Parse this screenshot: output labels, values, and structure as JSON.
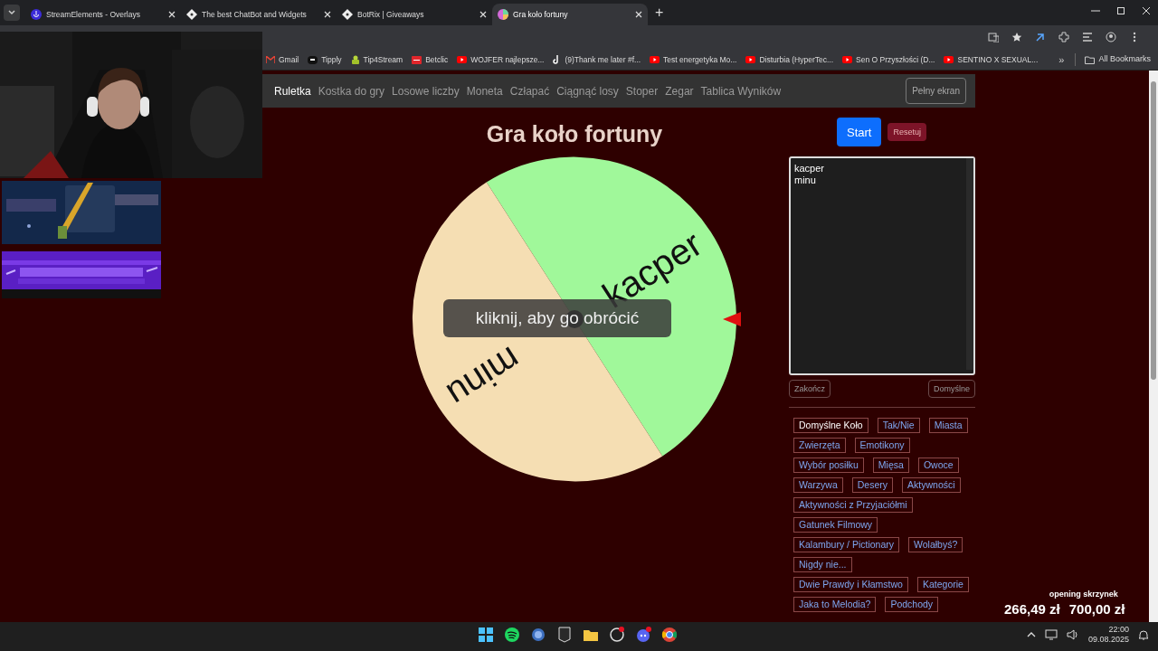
{
  "browser": {
    "tabs": [
      {
        "title": "StreamElements - Overlays",
        "kind": "streamelements",
        "selected": false
      },
      {
        "title": "The best ChatBot and Widgets",
        "kind": "diamond",
        "selected": false
      },
      {
        "title": "BotRix | Giveaways",
        "kind": "diamond",
        "selected": false
      },
      {
        "title": "Gra koło fortuny",
        "kind": "wheel",
        "selected": true
      }
    ],
    "bookmarks": [
      {
        "title": "Gmail",
        "kind": "gmail"
      },
      {
        "title": "Tipply",
        "kind": "tipply"
      },
      {
        "title": "Tip4Stream",
        "kind": "tip4stream"
      },
      {
        "title": "Betclic",
        "kind": "betclic"
      },
      {
        "title": "WOJFER najlepsze...",
        "kind": "youtube"
      },
      {
        "title": "(9)Thank me later #f...",
        "kind": "tiktok"
      },
      {
        "title": "Test energetyka Mo...",
        "kind": "youtube"
      },
      {
        "title": "Disturbia (HyperTec...",
        "kind": "youtube"
      },
      {
        "title": "Sen O Przyszłości (D...",
        "kind": "youtube"
      },
      {
        "title": "SENTINO X SEXUAL...",
        "kind": "youtube"
      }
    ],
    "new_tab": "+",
    "overflow": "»",
    "all_bookmarks": "All Bookmarks"
  },
  "nav": {
    "items": [
      {
        "label": "Ruletka",
        "selected": true
      },
      {
        "label": "Kostka do gry",
        "selected": false
      },
      {
        "label": "Losowe liczby",
        "selected": false
      },
      {
        "label": "Moneta",
        "selected": false
      },
      {
        "label": "Człapać",
        "selected": false
      },
      {
        "label": "Ciągnąć losy",
        "selected": false
      },
      {
        "label": "Stoper",
        "selected": false
      },
      {
        "label": "Zegar",
        "selected": false
      },
      {
        "label": "Tablica Wyników",
        "selected": false
      }
    ],
    "fullscreen": "Pełny ekran"
  },
  "title": "Gra koło fortuny",
  "wheel": {
    "segments": [
      {
        "label": "kacper",
        "color": "#a0f89a"
      },
      {
        "label": "minu",
        "color": "#f5deb3"
      }
    ],
    "hint": "kliknij, aby go obrócić"
  },
  "controls": {
    "start": "Start",
    "reset": "Resetuj"
  },
  "entries": {
    "value": "kacper\nminu"
  },
  "entry_buttons": [
    "Zakończ",
    "Domyślne"
  ],
  "presets": [
    {
      "label": "Domyślne Koło",
      "selected": true
    },
    {
      "label": "Tak/Nie",
      "selected": false
    },
    {
      "label": "Miasta",
      "selected": false
    },
    {
      "label": "Zwierzęta",
      "selected": false
    },
    {
      "label": "Emotikony",
      "selected": false
    },
    {
      "label": "Wybór posiłku",
      "selected": false
    },
    {
      "label": "Mięsa",
      "selected": false
    },
    {
      "label": "Owoce",
      "selected": false
    },
    {
      "label": "Warzywa",
      "selected": false
    },
    {
      "label": "Desery",
      "selected": false
    },
    {
      "label": "Aktywności",
      "selected": false
    },
    {
      "label": "Aktywności z Przyjaciółmi",
      "selected": false
    },
    {
      "label": "Gatunek Filmowy",
      "selected": false
    },
    {
      "label": "Kalambury / Pictionary",
      "selected": false
    },
    {
      "label": "Wolałbyś?",
      "selected": false
    },
    {
      "label": "Nigdy nie...",
      "selected": false
    },
    {
      "label": "Dwie Prawdy i Kłamstwo",
      "selected": false
    },
    {
      "label": "Kategorie",
      "selected": false
    },
    {
      "label": "Jaka to Melodia?",
      "selected": false
    },
    {
      "label": "Podchody",
      "selected": false
    }
  ],
  "overlay": {
    "title": "opening skrzynek",
    "amount": "266,49 zł",
    "goal": "700,00 zł"
  },
  "taskbar": {
    "time": "22:00",
    "date": "09.08.2025"
  }
}
